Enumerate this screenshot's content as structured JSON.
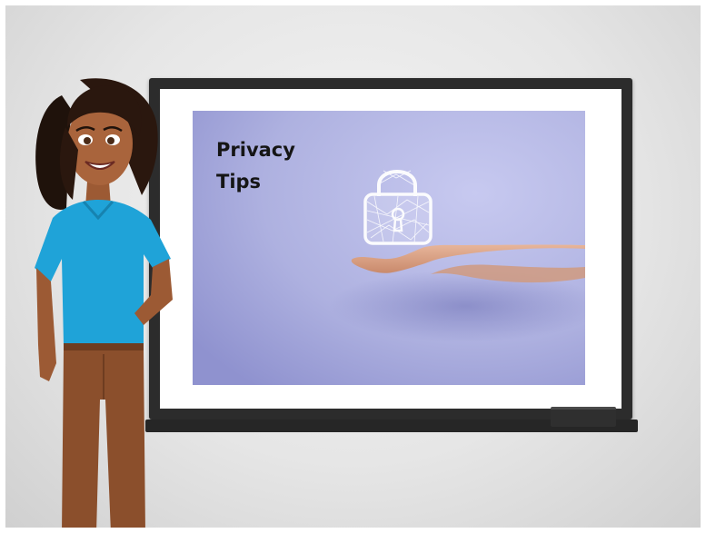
{
  "slide": {
    "title": "Privacy\nTips"
  },
  "icons": {
    "lock": "lock-icon",
    "hand": "hand-illustration",
    "presenter": "presenter-character"
  },
  "colors": {
    "slide_background": "#b7b9e6",
    "board_frame": "#2c2c2c",
    "presenter_shirt": "#1fa3d8",
    "presenter_pants": "#8b4f2c"
  }
}
